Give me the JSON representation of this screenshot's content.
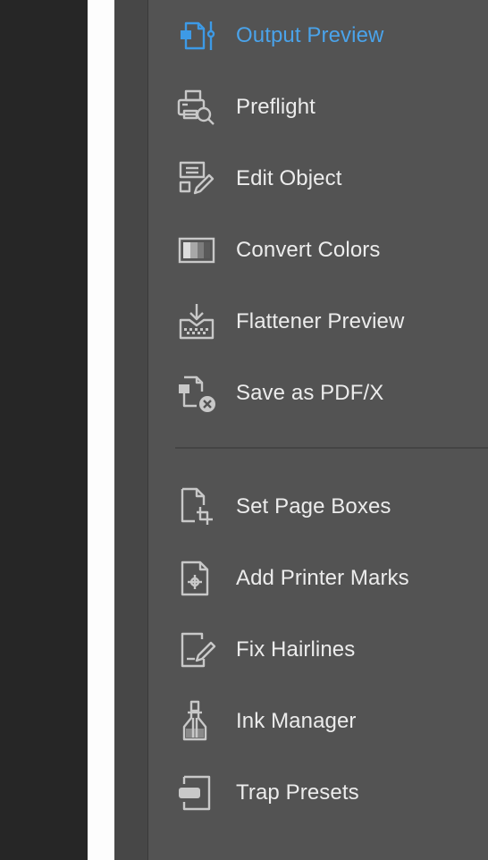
{
  "tools_group1": [
    {
      "label": "Output Preview",
      "icon": "output-preview-icon",
      "active": true
    },
    {
      "label": "Preflight",
      "icon": "preflight-icon"
    },
    {
      "label": "Edit Object",
      "icon": "edit-object-icon"
    },
    {
      "label": "Convert Colors",
      "icon": "convert-colors-icon"
    },
    {
      "label": "Flattener Preview",
      "icon": "flattener-preview-icon"
    },
    {
      "label": "Save as PDF/X",
      "icon": "save-as-pdfx-icon"
    }
  ],
  "tools_group2": [
    {
      "label": "Set Page Boxes",
      "icon": "set-page-boxes-icon"
    },
    {
      "label": "Add Printer Marks",
      "icon": "add-printer-marks-icon"
    },
    {
      "label": "Fix Hairlines",
      "icon": "fix-hairlines-icon"
    },
    {
      "label": "Ink Manager",
      "icon": "ink-manager-icon"
    },
    {
      "label": "Trap Presets",
      "icon": "trap-presets-icon"
    }
  ],
  "colors": {
    "active": "#4aa3ea",
    "text": "#ececec",
    "panel": "#535353",
    "icon": "#c8c8c8"
  }
}
